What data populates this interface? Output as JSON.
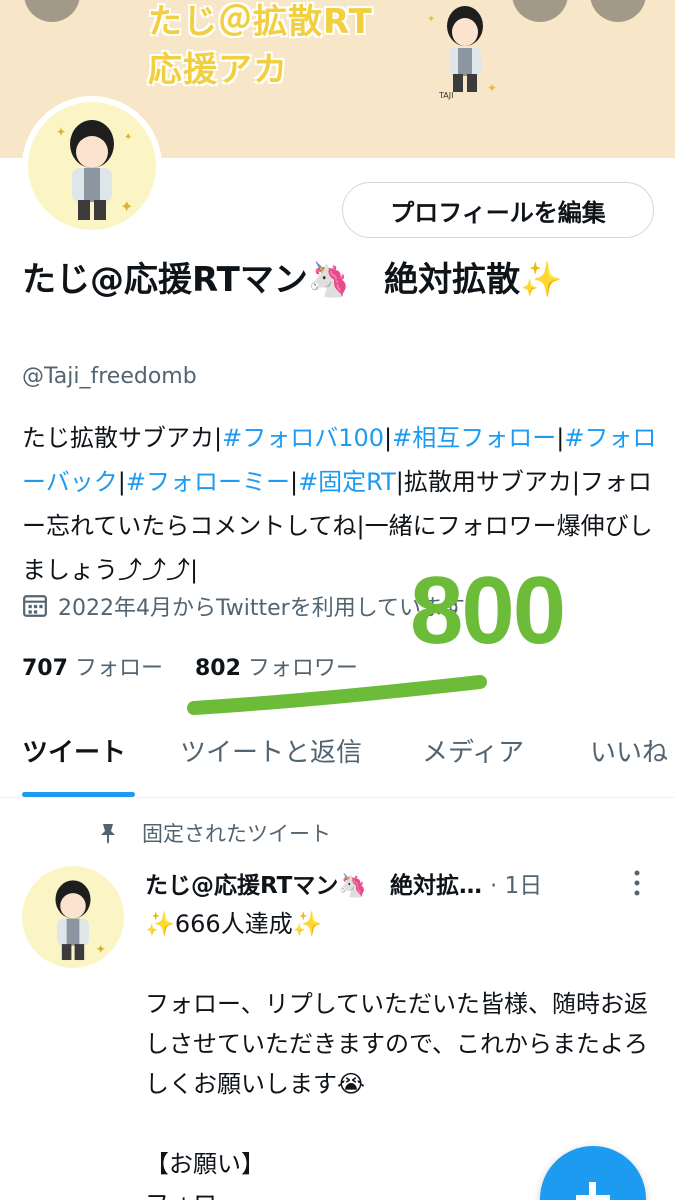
{
  "banner": {
    "line1": "たじ＠拡散RT",
    "line2": "応援アカ",
    "char_label": "TAJI"
  },
  "profile": {
    "edit_button": "プロフィールを編集",
    "display_name": "たじ@応援RTマン🦄　絶対拡散✨",
    "handle": "@Taji_freedomb",
    "bio": {
      "part1": "たじ拡散サブアカ|",
      "tag1": "#フォロバ100",
      "sep1": "|",
      "tag2": "#相互フォロー",
      "sep2": "|",
      "tag3": "#フォローバック",
      "sep3": "|",
      "tag4": "#フォローミー",
      "sep4": "|",
      "tag5": "#固定RT",
      "part2": "|拡散用サブアカ|フォロー忘れていたらコメントしてね|一緒にフォロワー爆伸びしましょう⤴︎⤴︎⤴︎|"
    },
    "joined": "2022年4月からTwitterを利用しています",
    "following_count": "707",
    "following_label": "フォロー",
    "followers_count": "802",
    "followers_label": "フォロワー",
    "annotation": "800"
  },
  "tabs": [
    {
      "label": "ツイート",
      "active": true
    },
    {
      "label": "ツイートと返信",
      "active": false
    },
    {
      "label": "メディア",
      "active": false
    },
    {
      "label": "いいね",
      "active": false
    }
  ],
  "pinned_tweet": {
    "pinned_label": "固定されたツイート",
    "author": "たじ@応援RTマン🦄　絶対拡…",
    "meta": "· 1日",
    "body": "✨666人達成✨\n\nフォロー、リプしていただいた皆様、随時お返しさせていただきますので、これからまたよろしくお願いします😭\n\n【お願い】\nフォロー"
  },
  "colors": {
    "accent": "#1d9bf0",
    "banner_bg": "#f7e6c7",
    "annotation_green": "#6cbc3a"
  }
}
